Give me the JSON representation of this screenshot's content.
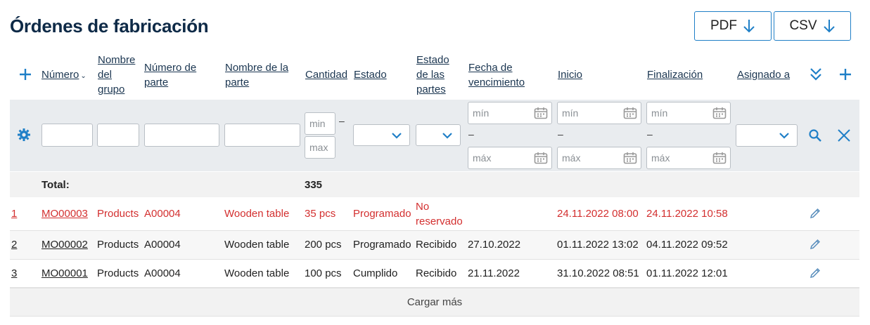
{
  "page_title": "Órdenes de fabricación",
  "toolbar": {
    "pdf_label": "PDF",
    "csv_label": "CSV"
  },
  "columns": {
    "numero": "Número",
    "grupo": "Nombre del grupo",
    "num_parte": "Número de parte",
    "nombre_parte": "Nombre de la parte",
    "cantidad": "Cantidad",
    "estado": "Estado",
    "estado_partes": "Estado de las partes",
    "vencimiento": "Fecha de vencimiento",
    "inicio": "Inicio",
    "finalizacion": "Finalización",
    "asignado": "Asignado a"
  },
  "filters": {
    "min_short": "min",
    "max_short": "max",
    "min_date": "mín",
    "max_date": "máx",
    "range_sep": "–"
  },
  "totals": {
    "label": "Total:",
    "cantidad": "335"
  },
  "rows": [
    {
      "index": "1",
      "numero": "MO00003",
      "grupo": "Products",
      "num_parte": "A00004",
      "nombre_parte": "Wooden table",
      "cantidad": "35 pcs",
      "estado": "Programado",
      "estado_partes_1": "No",
      "estado_partes_2": "reservado",
      "vencimiento": "",
      "inicio": "24.11.2022 08:00",
      "finalizacion": "24.11.2022 10:58",
      "asignado": "",
      "highlight": true
    },
    {
      "index": "2",
      "numero": "MO00002",
      "grupo": "Products",
      "num_parte": "A00004",
      "nombre_parte": "Wooden table",
      "cantidad": "200 pcs",
      "estado": "Programado",
      "estado_partes": "Recibido",
      "vencimiento": "27.10.2022",
      "inicio": "01.11.2022 13:02",
      "finalizacion": "04.11.2022 09:52",
      "asignado": ""
    },
    {
      "index": "3",
      "numero": "MO00001",
      "grupo": "Products",
      "num_parte": "A00004",
      "nombre_parte": "Wooden table",
      "cantidad": "100 pcs",
      "estado": "Cumplido",
      "estado_partes": "Recibido",
      "vencimiento": "21.11.2022",
      "inicio": "31.10.2022 08:51",
      "finalizacion": "01.11.2022 12:01",
      "asignado": ""
    }
  ],
  "load_more": "Cargar más",
  "colors": {
    "accent": "#1f7fc7",
    "title": "#0e2a47",
    "error": "#d32f2f",
    "filter_bg": "#e9ecef",
    "total_bg": "#f2f2f2"
  }
}
